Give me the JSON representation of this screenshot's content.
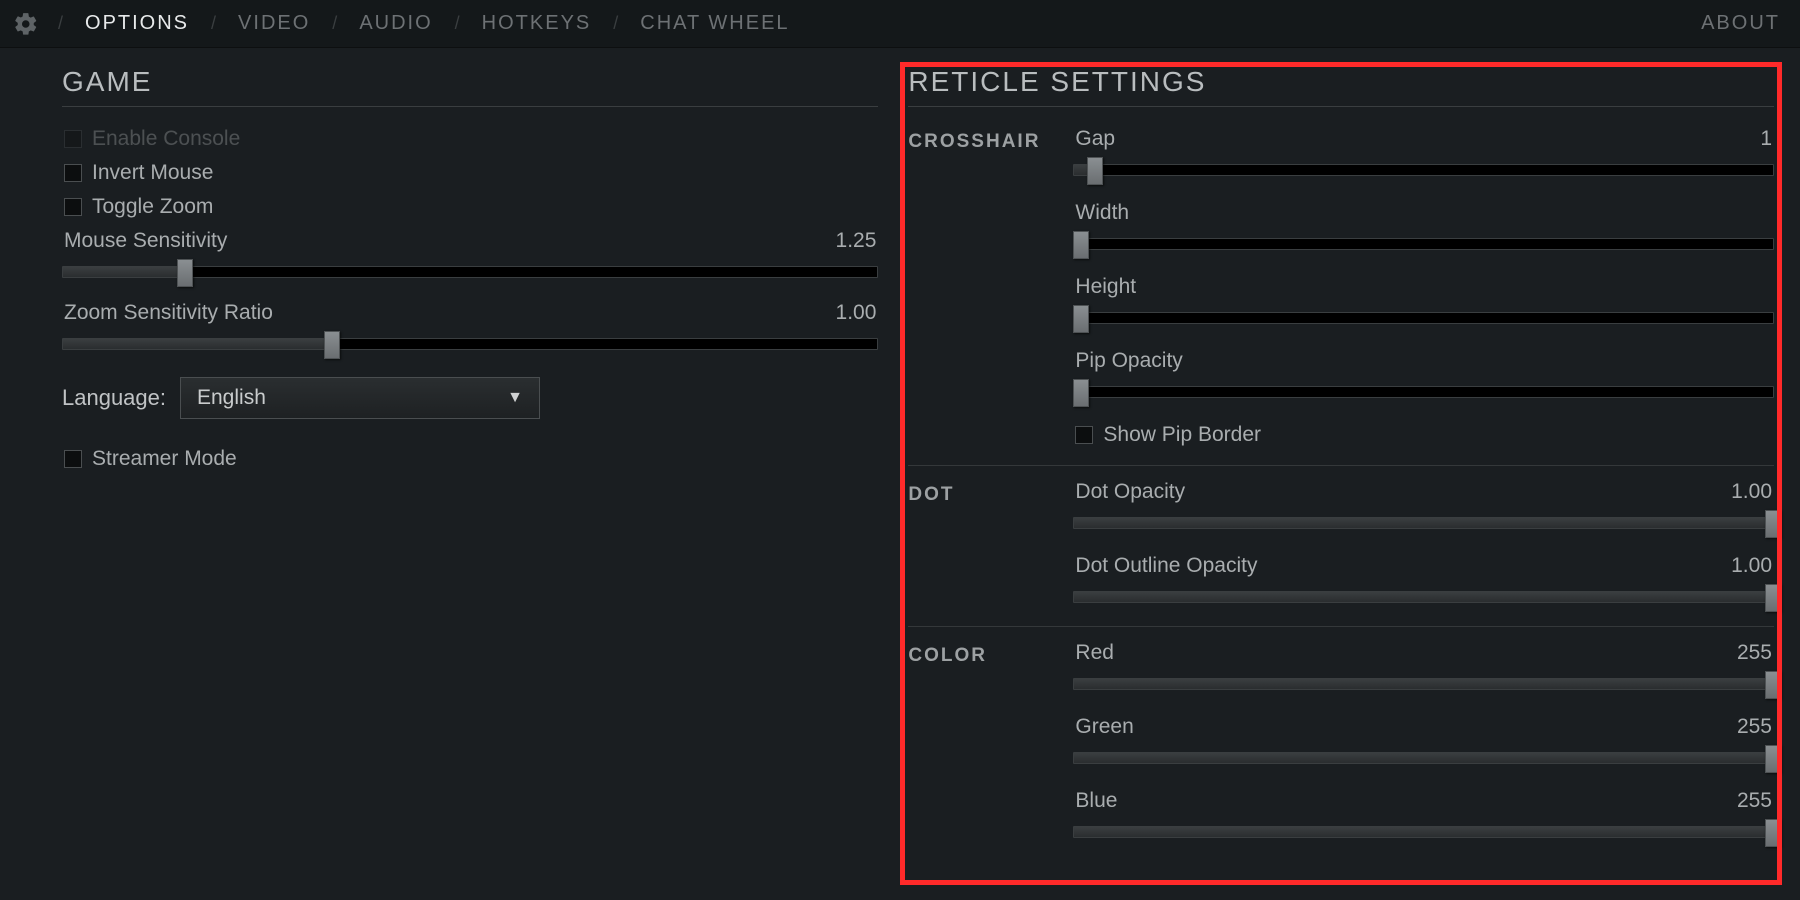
{
  "nav": {
    "tabs": [
      "OPTIONS",
      "VIDEO",
      "AUDIO",
      "HOTKEYS",
      "CHAT WHEEL"
    ],
    "active": "OPTIONS",
    "about": "ABOUT"
  },
  "game": {
    "title": "GAME",
    "enable_console": "Enable Console",
    "invert_mouse": "Invert Mouse",
    "toggle_zoom": "Toggle Zoom",
    "mouse_sens": {
      "label": "Mouse Sensitivity",
      "value": "1.25",
      "pct": 15
    },
    "zoom_sens": {
      "label": "Zoom Sensitivity Ratio",
      "value": "1.00",
      "pct": 33
    },
    "language_label": "Language:",
    "language_value": "English",
    "streamer_mode": "Streamer Mode"
  },
  "reticle": {
    "title": "RETICLE SETTINGS",
    "crosshair": {
      "label": "CROSSHAIR",
      "gap": {
        "label": "Gap",
        "value": "1",
        "pct": 3
      },
      "width": {
        "label": "Width",
        "value": "",
        "pct": 1
      },
      "height": {
        "label": "Height",
        "value": "",
        "pct": 1
      },
      "pip_opacity": {
        "label": "Pip Opacity",
        "value": "",
        "pct": 1
      },
      "show_pip_border": "Show Pip Border"
    },
    "dot": {
      "label": "DOT",
      "dot_opacity": {
        "label": "Dot Opacity",
        "value": "1.00",
        "pct": 100
      },
      "dot_outline_opacity": {
        "label": "Dot Outline Opacity",
        "value": "1.00",
        "pct": 100
      }
    },
    "color": {
      "label": "COLOR",
      "red": {
        "label": "Red",
        "value": "255",
        "pct": 100
      },
      "green": {
        "label": "Green",
        "value": "255",
        "pct": 100
      },
      "blue": {
        "label": "Blue",
        "value": "255",
        "pct": 100
      }
    }
  }
}
